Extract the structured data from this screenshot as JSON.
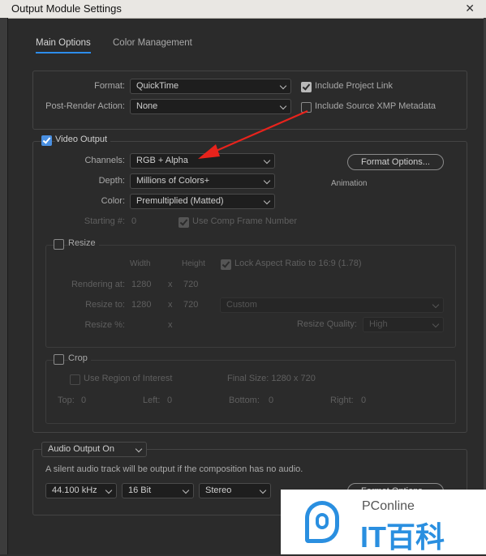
{
  "window": {
    "title": "Output Module Settings",
    "close_glyph": "✕"
  },
  "tabs": {
    "main_options": "Main Options",
    "color_management": "Color Management"
  },
  "format": {
    "format_label": "Format:",
    "format_value": "QuickTime",
    "post_render_label": "Post-Render Action:",
    "post_render_value": "None",
    "include_project_link": "Include Project Link",
    "include_xmp": "Include Source XMP Metadata"
  },
  "video": {
    "video_output_label": "Video Output",
    "channels_label": "Channels:",
    "channels_value": "RGB + Alpha",
    "depth_label": "Depth:",
    "depth_value": "Millions of Colors+",
    "color_label": "Color:",
    "color_value": "Premultiplied (Matted)",
    "starting_label": "Starting #:",
    "starting_value": "0",
    "use_comp_frame": "Use Comp Frame Number",
    "format_options_btn": "Format Options...",
    "codec_info": "Animation"
  },
  "resize": {
    "label": "Resize",
    "width_header": "Width",
    "height_header": "Height",
    "lock_aspect": "Lock Aspect Ratio to 16:9 (1.78)",
    "rendering_at_label": "Rendering at:",
    "rendering_w": "1280",
    "rendering_h": "720",
    "resize_to_label": "Resize to:",
    "resize_to_w": "1280",
    "resize_to_h": "720",
    "resize_preset": "Custom",
    "resize_pct_label": "Resize %:",
    "x": "x",
    "quality_label": "Resize Quality:",
    "quality_value": "High"
  },
  "crop": {
    "label": "Crop",
    "use_roi": "Use Region of Interest",
    "final_size": "Final Size: 1280 x 720",
    "top_label": "Top:",
    "top_value": "0",
    "left_label": "Left:",
    "left_value": "0",
    "bottom_label": "Bottom:",
    "bottom_value": "0",
    "right_label": "Right:",
    "right_value": "0"
  },
  "audio": {
    "audio_output_value": "Audio Output On",
    "note": "A silent audio track will be output if the composition has no audio.",
    "sample_rate": "44.100 kHz",
    "bit_depth": "16 Bit",
    "channels": "Stereo",
    "format_options_btn": "Format Options..."
  },
  "watermark": {
    "brand_top": "PConline",
    "brand_main": "IT百科"
  },
  "colors": {
    "accent": "#2d8ceb",
    "annotation_arrow": "#e8231c",
    "checkbox_blue": "#4a90e2"
  }
}
